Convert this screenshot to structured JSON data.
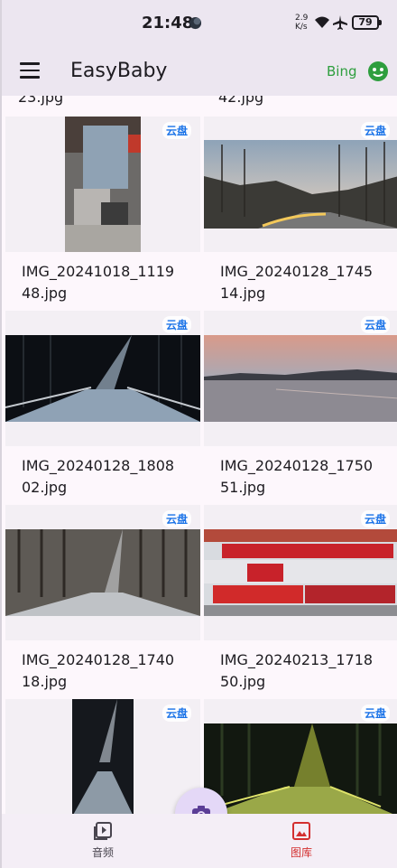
{
  "status_bar": {
    "time": "21:48",
    "net_speed_top": "2.9",
    "net_speed_unit": "K/s",
    "battery": "79",
    "icons": [
      "moon-icon",
      "wifi-icon",
      "airplane-icon",
      "battery-icon"
    ]
  },
  "app_bar": {
    "title": "EasyBaby",
    "bing_label": "Bing",
    "menu_icon": "menu-icon",
    "profile_icon": "face-icon"
  },
  "partial_captions": [
    "23.jpg",
    "42.jpg"
  ],
  "cloud_badge": "云盘",
  "photos": [
    {
      "name_line1": "IMG_20241018_1119",
      "name_line2": "48.jpg"
    },
    {
      "name_line1": "IMG_20240128_1745",
      "name_line2": "14.jpg"
    },
    {
      "name_line1": "IMG_20240128_1808",
      "name_line2": "02.jpg"
    },
    {
      "name_line1": "IMG_20240128_1750",
      "name_line2": "51.jpg"
    },
    {
      "name_line1": "IMG_20240128_1740",
      "name_line2": "18.jpg"
    },
    {
      "name_line1": "IMG_20240213_1718",
      "name_line2": "50.jpg"
    },
    {
      "name_line1": "",
      "name_line2": ""
    },
    {
      "name_line1": "",
      "name_line2": ""
    }
  ],
  "fab_icon": "camera-switch-icon",
  "bottom_nav": {
    "audio_label": "音频",
    "gallery_label": "图库",
    "active": "gallery",
    "colors": {
      "active": "#d32f2f",
      "inactive": "#49454f"
    }
  }
}
